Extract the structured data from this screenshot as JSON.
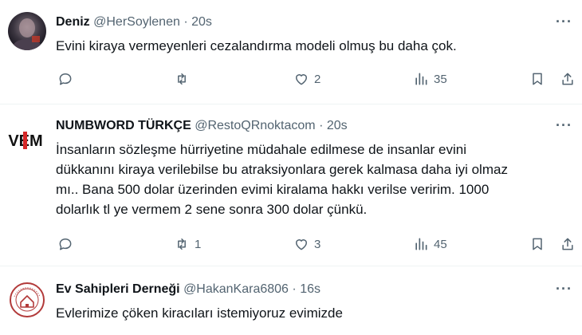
{
  "tweets": [
    {
      "name": "Deniz",
      "handle": "@HerSoylenen",
      "dot": "·",
      "time": "20s",
      "text": "Evini kiraya vermeyenleri cezalandırma modeli olmuş bu daha çok.",
      "replies": "",
      "retweets": "",
      "likes": "2",
      "views": "35"
    },
    {
      "name": "NUMBWORD TÜRKÇE",
      "handle": "@RestoQRnoktacom",
      "dot": "·",
      "time": "20s",
      "avatar_text": "VEM",
      "text_lines": [
        "İnsanların sözleşme hürriyetine müdahale edilmese de insanlar evini",
        "dükkanını kiraya verilebilse bu atraksiyonlara gerek kalmasa daha iyi olmaz",
        "mı.. Bana 500 dolar üzerinden evimi kiralama hakkı verilse veririm. 1000",
        "dolarlık tl ye vermem 2 sene sonra 300 dolar çünkü."
      ],
      "replies": "",
      "retweets": "1",
      "likes": "3",
      "views": "45"
    },
    {
      "name": "Ev Sahipleri Derneği",
      "handle": "@HakanKara6806",
      "dot": "·",
      "time": "16s",
      "text": "Evlerimize çöken kiracıları istemiyoruz evimizde"
    }
  ],
  "more_label": "···",
  "colors": {
    "text": "#0f1419",
    "secondary": "#536471",
    "divider": "#eff3f4"
  }
}
